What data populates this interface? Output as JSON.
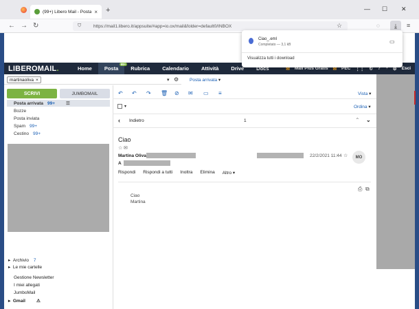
{
  "browser": {
    "tab_title": "(99+) Libero Mail - Posta",
    "tab_close": "×",
    "new_tab": "+",
    "url": "https://mail1.libero.it/appsuite/#app=io.ox/mail&folder=default0/INBOX",
    "window_controls": [
      "—",
      "☐",
      "✕"
    ],
    "nav": [
      "←",
      "→",
      "↻"
    ]
  },
  "downloads": {
    "filename": "Ciao_.eml",
    "status": "Completato — 3,1 kB",
    "show_all": "Visualizza tutti i download"
  },
  "libero_nav": {
    "logo_a": "LIBERO",
    "logo_b": "MAIL",
    "logo_dot": ".",
    "items": [
      "Home",
      "Posta",
      "Rubrica",
      "Calendario",
      "Attività",
      "Drive",
      "Docs"
    ],
    "posta_badge": "99+",
    "plus": "Mail Plus Gratis",
    "pec": "PEC",
    "exit": "Esci"
  },
  "search": {
    "chip": "martinaoliva",
    "chip_x": "×",
    "scope": "Posta arrivata"
  },
  "sidebar": {
    "compose": "SCRIVI",
    "jumbo": "JUMBOMAIL",
    "folders": [
      {
        "name": "Posta arrivata",
        "count": "99+"
      },
      {
        "name": "Bozze",
        "count": ""
      },
      {
        "name": "Posta inviata",
        "count": ""
      },
      {
        "name": "Spam",
        "count": "99+"
      },
      {
        "name": "Cestino",
        "count": "99+"
      }
    ],
    "archive": "Archivio",
    "archive_count": "7",
    "my_folders": "Le mie cartelle",
    "links": [
      "Gestione Newsletter",
      "I miei allegati",
      "JumboMail"
    ],
    "gmail": "Gmail"
  },
  "toolbar": {
    "view": "Vista",
    "sort": "Ordina"
  },
  "list": {
    "back": "Indietro",
    "count": "1"
  },
  "message": {
    "subject": "Ciao",
    "sender": "Martina Oliva",
    "to_label": "A",
    "date": "22/2/2021 11:44",
    "avatar": "MO",
    "actions": [
      "Rispondi",
      "Rispondi a tutti",
      "Inoltra",
      "Elimina",
      "Altro"
    ],
    "body": [
      "Ciao",
      "Martina"
    ]
  }
}
